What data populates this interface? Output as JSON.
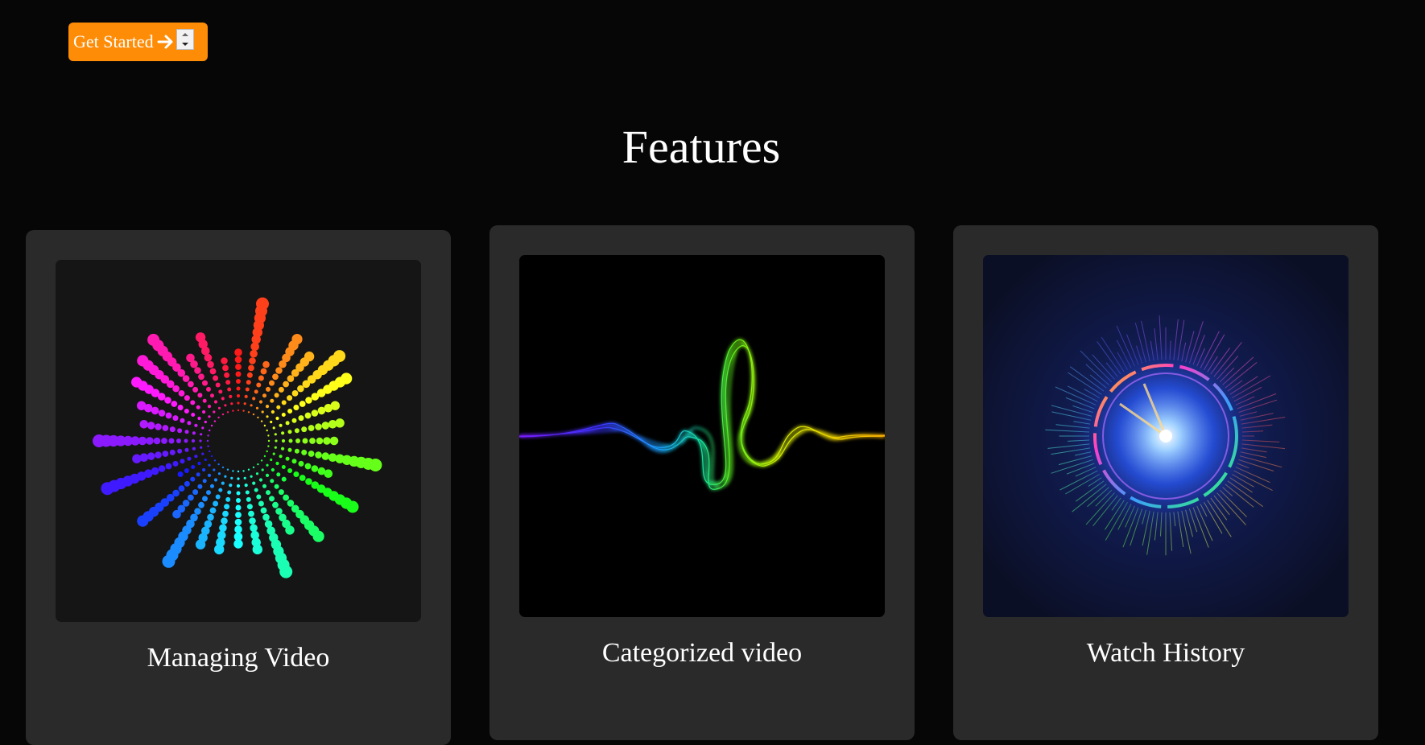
{
  "header": {
    "cta_label": "Get Started",
    "cta_icon": "arrow-right-icon",
    "accent_color": "#ff8c06"
  },
  "features": {
    "title": "Features",
    "cards": [
      {
        "label": "Managing Video",
        "image": "radial-dot-equalizer"
      },
      {
        "label": "Categorized video",
        "image": "rainbow-sound-wave"
      },
      {
        "label": "Watch History",
        "image": "neon-circular-dial"
      }
    ]
  }
}
